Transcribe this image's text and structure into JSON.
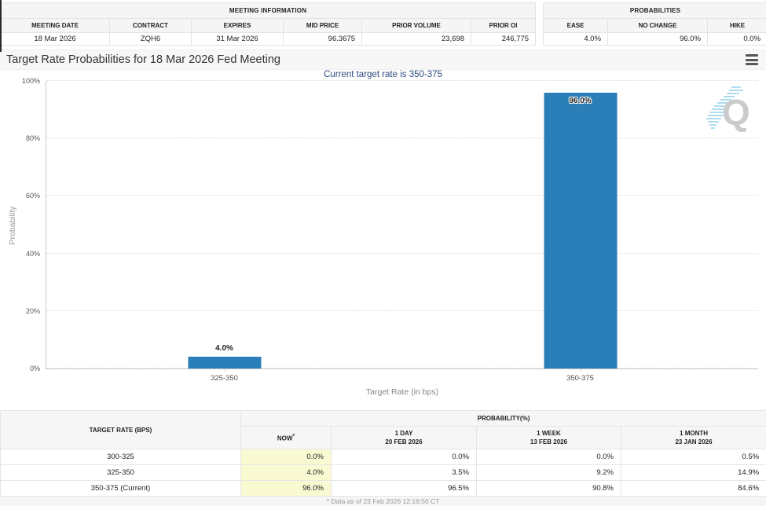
{
  "meeting_information": {
    "title": "MEETING INFORMATION",
    "columns": [
      "MEETING DATE",
      "CONTRACT",
      "EXPIRES",
      "MID PRICE",
      "PRIOR VOLUME",
      "PRIOR OI"
    ],
    "values": [
      "18 Mar 2026",
      "ZQH6",
      "31 Mar 2026",
      "96.3675",
      "23,698",
      "246,775"
    ]
  },
  "probabilities_summary": {
    "title": "PROBABILITIES",
    "columns": [
      "EASE",
      "NO CHANGE",
      "HIKE"
    ],
    "values": [
      "4.0%",
      "96.0%",
      "0.0%"
    ]
  },
  "chart_data": {
    "type": "bar",
    "title": "Target Rate Probabilities for 18 Mar 2026 Fed Meeting",
    "subtitle": "Current target rate is 350-375",
    "categories": [
      "325-350",
      "350-375"
    ],
    "values": [
      4.0,
      96.0
    ],
    "labels": [
      "4.0%",
      "96.0%"
    ],
    "xlabel": "Target Rate (in bps)",
    "ylabel": "Probability",
    "ylim": [
      0,
      100
    ],
    "y_ticks": [
      "0%",
      "20%",
      "40%",
      "60%",
      "80%",
      "100%"
    ],
    "bar_color": "#2a7fb8",
    "grid": "horizontal-dotted",
    "legend": "none"
  },
  "watermark": {
    "letter": "Q"
  },
  "history_table": {
    "col1_header": "TARGET RATE (BPS)",
    "group_header": "PROBABILITY(%)",
    "sub_headers": {
      "now": {
        "label": "NOW",
        "sup": "*"
      },
      "day": {
        "line1": "1 DAY",
        "line2": "20 FEB 2026"
      },
      "week": {
        "line1": "1 WEEK",
        "line2": "13 FEB 2026"
      },
      "month": {
        "line1": "1 MONTH",
        "line2": "23 JAN 2026"
      }
    },
    "rows": [
      {
        "rate": "300-325",
        "now": "0.0%",
        "day": "0.0%",
        "week": "0.0%",
        "month": "0.5%"
      },
      {
        "rate": "325-350",
        "now": "4.0%",
        "day": "3.5%",
        "week": "9.2%",
        "month": "14.9%"
      },
      {
        "rate": "350-375 (Current)",
        "now": "96.0%",
        "day": "96.5%",
        "week": "90.8%",
        "month": "84.6%"
      }
    ],
    "footnote": "* Data as of 23 Feb 2026 12:16:50 CT"
  }
}
